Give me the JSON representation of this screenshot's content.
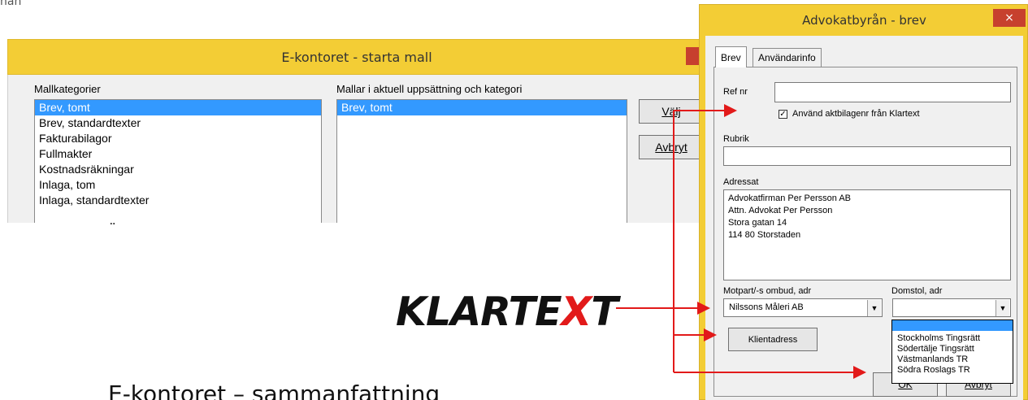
{
  "fragment_top": "nan",
  "caption": "E-kontoret – sammanfattning",
  "diacritic": "¨",
  "start_dialog": {
    "title": "E-kontoret - starta mall",
    "categories_label": "Mallkategorier",
    "templates_label": "Mallar i aktuell uppsättning och kategori",
    "categories": [
      "Brev, tomt",
      "Brev, standardtexter",
      "Fakturabilagor",
      "Fullmakter",
      "Kostnadsräkningar",
      "Inlaga, tom",
      "Inlaga, standardtexter"
    ],
    "templates": [
      "Brev, tomt"
    ],
    "choose_button": "Välj",
    "cancel_button": "Avbryt"
  },
  "logo": {
    "part1": "KLARTE",
    "part2": "X",
    "part3": "T"
  },
  "letter_dialog": {
    "title": "Advokatbyrån - brev",
    "close": "×",
    "tabs": [
      "Brev",
      "Användarinfo"
    ],
    "ref_label": "Ref nr",
    "ref_value": "",
    "checkbox_label": "Använd aktbilagenr från Klartext",
    "checkbox_mark": "✓",
    "subject_label": "Rubrik",
    "subject_value": "",
    "addressee_label": "Adressat",
    "addressee_value": "Advokatfirman Per Persson AB\nAttn. Advokat Per Persson\nStora gatan 14\n114 80 Storstaden",
    "counterpart_label": "Motpart/-s ombud, adr",
    "counterpart_value": "Nilssons Måleri AB",
    "court_label": "Domstol, adr",
    "court_value": "",
    "court_options": [
      "",
      "Stockholms Tingsrätt",
      "Södertälje Tingsrätt",
      "Västmanlands TR",
      "Södra Roslags TR"
    ],
    "client_address_button": "Klientadress",
    "ok_button": "OK",
    "cancel_button": "Avbryt"
  }
}
